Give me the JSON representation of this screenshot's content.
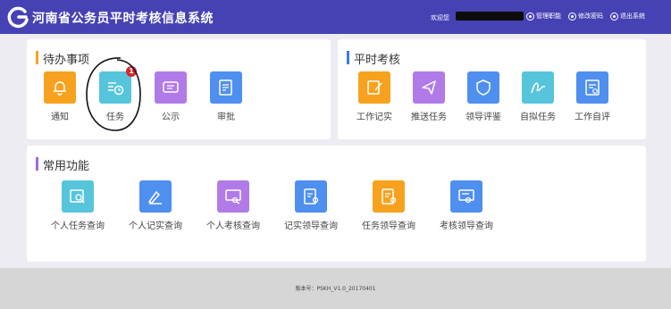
{
  "header": {
    "title": "河南省公务员平时考核信息系统",
    "welcome": "欢迎您",
    "links": [
      {
        "label": "管理职能",
        "icon": "settings-icon"
      },
      {
        "label": "修改密码",
        "icon": "key-icon"
      },
      {
        "label": "退出系统",
        "icon": "logout-icon"
      }
    ]
  },
  "todo": {
    "title": "待办事项",
    "items": [
      {
        "label": "通知",
        "icon": "bell-icon",
        "color": "#f6a21f"
      },
      {
        "label": "任务",
        "icon": "task-clock-icon",
        "color": "#56c5dc",
        "badge": "1"
      },
      {
        "label": "公示",
        "icon": "announcement-icon",
        "color": "#b07be8"
      },
      {
        "label": "审批",
        "icon": "approval-icon",
        "color": "#4f8ff0"
      }
    ]
  },
  "assessment": {
    "title": "平时考核",
    "items": [
      {
        "label": "工作记实",
        "icon": "edit-record-icon",
        "color": "#f6a21f"
      },
      {
        "label": "推送任务",
        "icon": "send-icon",
        "color": "#b07be8"
      },
      {
        "label": "领导评鉴",
        "icon": "shield-icon",
        "color": "#4f8ff0"
      },
      {
        "label": "自拟任务",
        "icon": "signature-icon",
        "color": "#56c5dc"
      },
      {
        "label": "工作自评",
        "icon": "self-review-icon",
        "color": "#4f8ff0"
      }
    ]
  },
  "common": {
    "title": "常用功能",
    "items": [
      {
        "label": "个人任务查询",
        "icon": "task-search-icon",
        "color": "#56c5dc"
      },
      {
        "label": "个人记实查询",
        "icon": "record-search-icon",
        "color": "#4f8ff0"
      },
      {
        "label": "个人考核查询",
        "icon": "assessment-search-icon",
        "color": "#b07be8"
      },
      {
        "label": "记实领导查询",
        "icon": "leader-record-icon",
        "color": "#4f8ff0"
      },
      {
        "label": "任务领导查询",
        "icon": "leader-task-icon",
        "color": "#f6a21f"
      },
      {
        "label": "考核领导查询",
        "icon": "leader-assessment-icon",
        "color": "#4f8ff0"
      }
    ]
  },
  "footer": {
    "version": "版本号：PSKH_V1.0_20170401"
  }
}
